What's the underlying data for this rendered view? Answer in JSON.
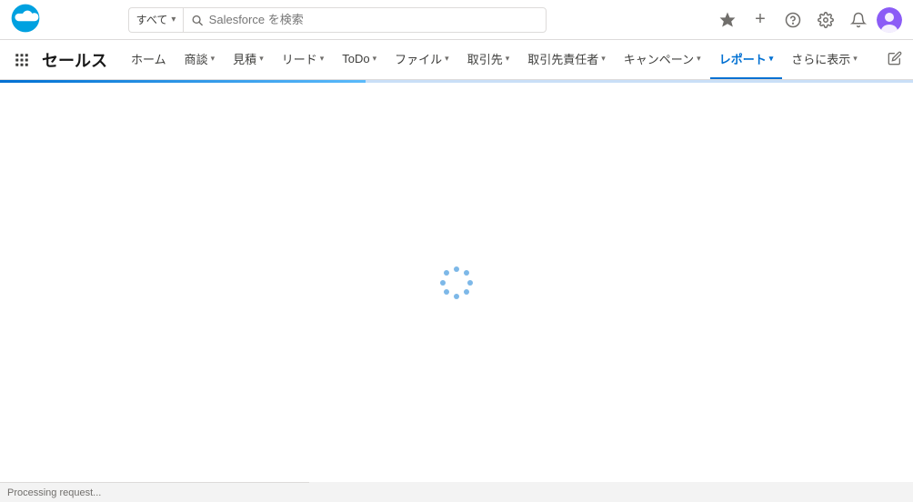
{
  "topbar": {
    "search_scope": "すべて",
    "search_placeholder": "Salesforce を検索",
    "chevron_down": "▾",
    "favorite_icon": "★",
    "add_icon": "+",
    "help_icon": "?",
    "settings_icon": "⚙",
    "notification_icon": "🔔"
  },
  "navbar": {
    "app_name": "セールス",
    "items": [
      {
        "label": "ホーム",
        "has_chevron": false,
        "active": false
      },
      {
        "label": "商談",
        "has_chevron": true,
        "active": false
      },
      {
        "label": "見積",
        "has_chevron": true,
        "active": false
      },
      {
        "label": "リード",
        "has_chevron": true,
        "active": false
      },
      {
        "label": "ToDo",
        "has_chevron": true,
        "active": false
      },
      {
        "label": "ファイル",
        "has_chevron": true,
        "active": false
      },
      {
        "label": "取引先",
        "has_chevron": true,
        "active": false
      },
      {
        "label": "取引先責任者",
        "has_chevron": true,
        "active": false
      },
      {
        "label": "キャンペーン",
        "has_chevron": true,
        "active": false
      },
      {
        "label": "レポート",
        "has_chevron": true,
        "active": true
      },
      {
        "label": "さらに表示",
        "has_chevron": true,
        "active": false
      }
    ],
    "edit_icon": "✎"
  },
  "status": {
    "text": "Processing request..."
  }
}
